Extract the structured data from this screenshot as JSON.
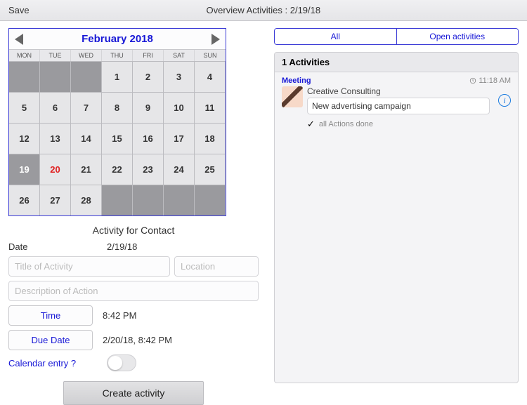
{
  "header": {
    "save": "Save",
    "title": "Overview Activities : 2/19/18"
  },
  "calendar": {
    "title": "February 2018",
    "dow": [
      "MON",
      "TUE",
      "WED",
      "THU",
      "FRI",
      "SAT",
      "SUN"
    ],
    "leading_blanks": 3,
    "days": 28,
    "selected": 19,
    "today": 20
  },
  "form": {
    "heading": "Activity for Contact",
    "date_label": "Date",
    "date_value": "2/19/18",
    "title_ph": "Title of Activity",
    "location_ph": "Location",
    "desc_ph": "Description of Action",
    "time_btn": "Time",
    "time_value": "8:42 PM",
    "due_btn": "Due Date",
    "due_value": "2/20/18, 8:42 PM",
    "cal_entry": "Calendar entry ?",
    "create": "Create activity"
  },
  "tabs": {
    "all": "All",
    "open": "Open activities"
  },
  "panel": {
    "heading": "1 Activities",
    "activity": {
      "type": "Meeting",
      "time": "11:18 AM",
      "contact": "Creative Consulting",
      "subject": "New advertising campaign",
      "done": "all Actions done"
    }
  }
}
